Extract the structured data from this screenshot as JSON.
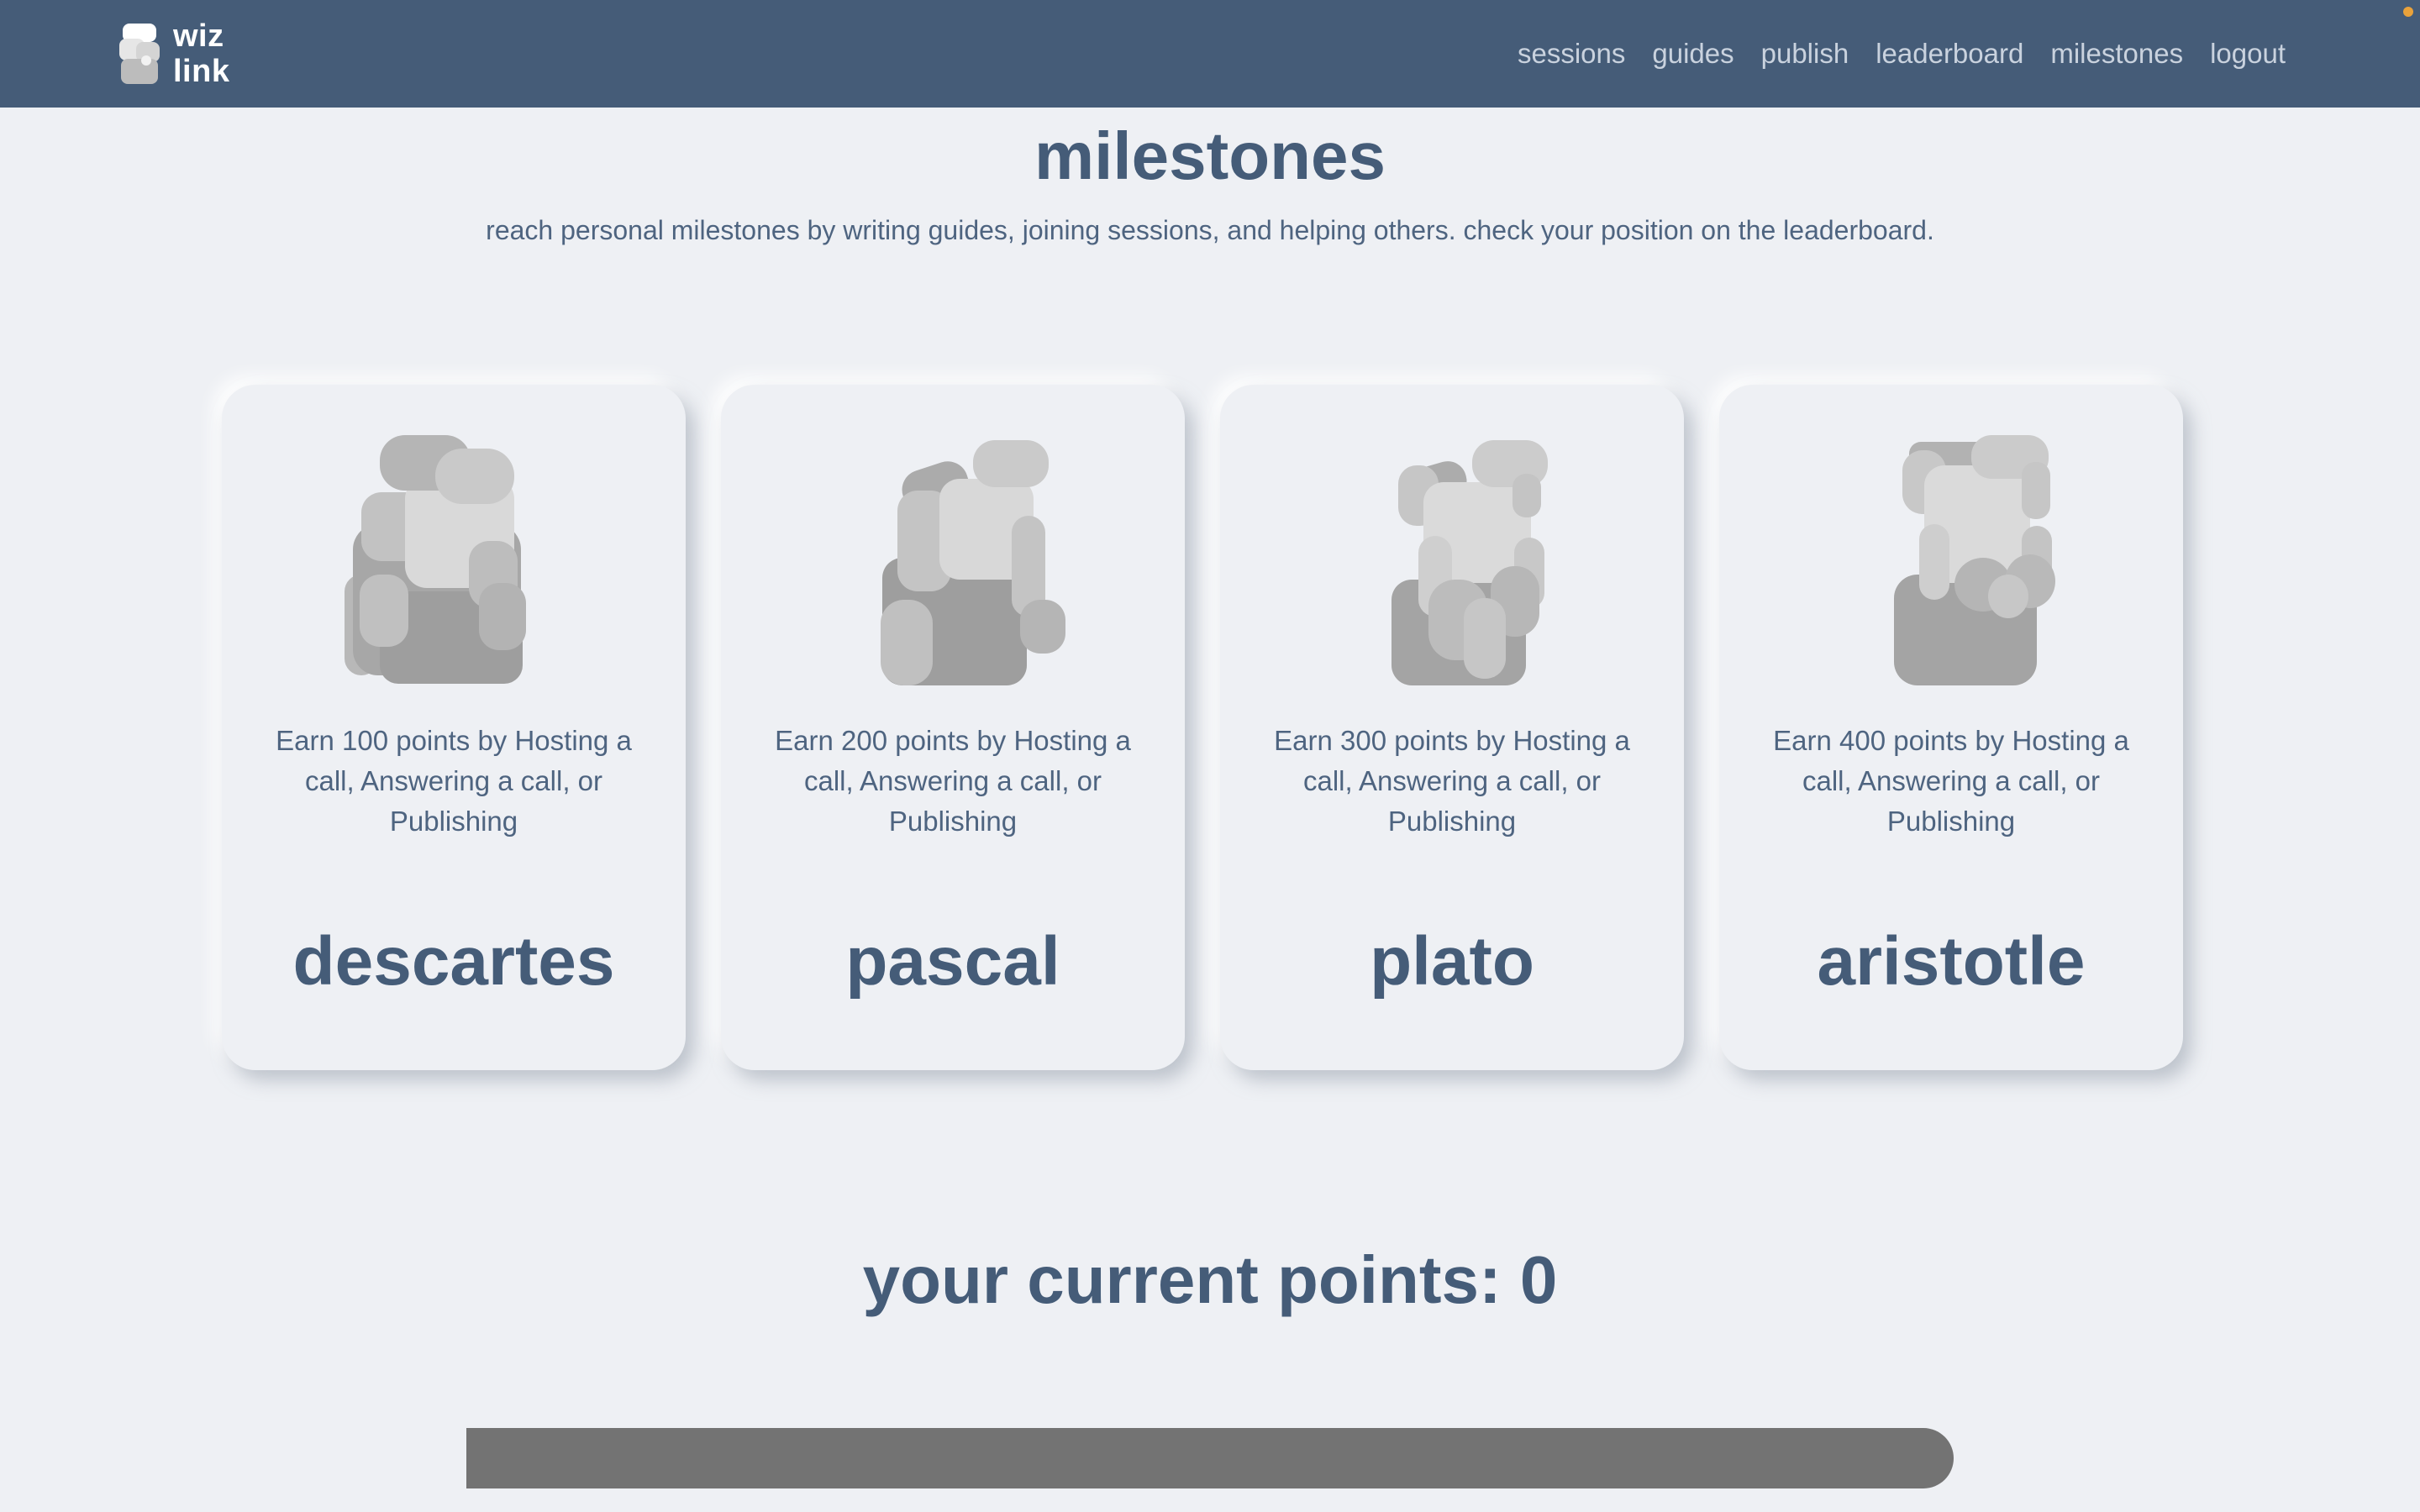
{
  "brand": {
    "line1": "wiz",
    "line2": "link"
  },
  "nav": {
    "items": [
      {
        "label": "sessions"
      },
      {
        "label": "guides"
      },
      {
        "label": "publish"
      },
      {
        "label": "leaderboard"
      },
      {
        "label": "milestones"
      },
      {
        "label": "logout"
      }
    ]
  },
  "page": {
    "title": "milestones",
    "subtitle": "reach personal milestones by writing guides, joining sessions, and helping others. check your position on the leaderboard."
  },
  "milestones": [
    {
      "name": "descartes",
      "description": "Earn 100 points by Hosting a call, Answering a call, or Publishing",
      "icon": "descartes-bust-icon"
    },
    {
      "name": "pascal",
      "description": "Earn 200 points by Hosting a call, Answering a call, or Publishing",
      "icon": "pascal-bust-icon"
    },
    {
      "name": "plato",
      "description": "Earn 300 points by Hosting a call, Answering a call, or Publishing",
      "icon": "plato-bust-icon"
    },
    {
      "name": "aristotle",
      "description": "Earn 400 points by Hosting a call, Answering a call, or Publishing",
      "icon": "aristotle-bust-icon"
    }
  ],
  "points": {
    "label": "your current points: 0",
    "value": 0,
    "progress_fraction": 0
  },
  "colors": {
    "header": "#455c78",
    "background": "#eef0f4",
    "progress_track": "#737373",
    "accent_dot": "#e9a23b"
  }
}
